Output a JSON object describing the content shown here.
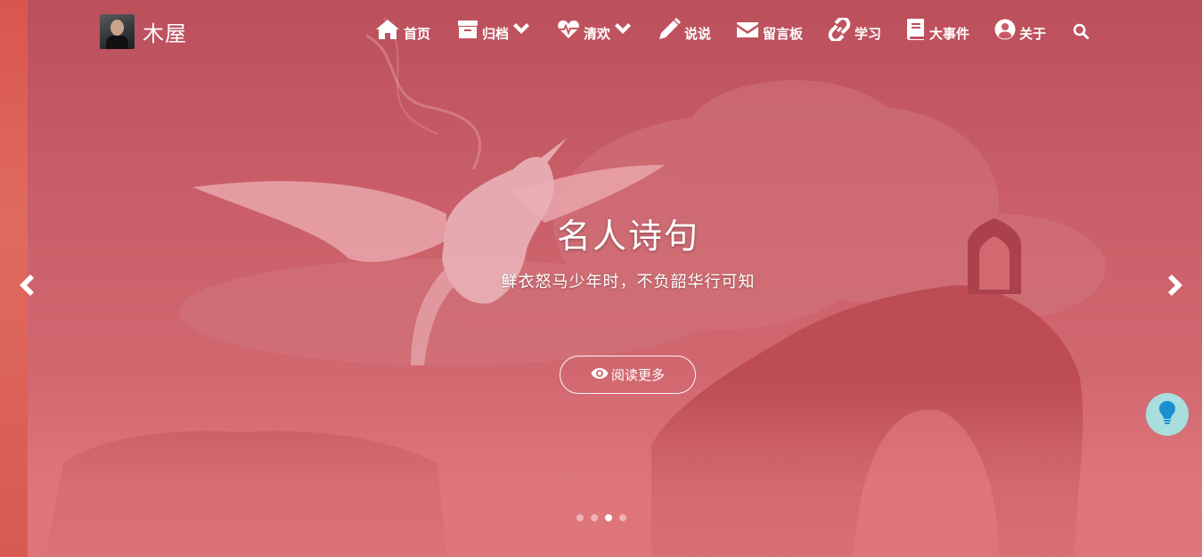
{
  "brand": {
    "name": "木屋"
  },
  "nav": {
    "items": [
      {
        "label": "首页",
        "icon": "home-icon"
      },
      {
        "label": "归档",
        "icon": "archive-icon",
        "dropdown": true
      },
      {
        "label": "清欢",
        "icon": "heartbeat-icon",
        "dropdown": true
      },
      {
        "label": "说说",
        "icon": "pencil-icon"
      },
      {
        "label": "留言板",
        "icon": "envelope-icon"
      },
      {
        "label": "学习",
        "icon": "link-icon"
      },
      {
        "label": "大事件",
        "icon": "book-icon"
      },
      {
        "label": "关于",
        "icon": "user-circle-icon"
      }
    ],
    "search_icon": "search-icon"
  },
  "hero": {
    "title": "名人诗句",
    "subtitle": "鲜衣怒马少年时，不负韶华行可知",
    "button_label": "阅读更多",
    "button_icon": "eye-icon"
  },
  "carousel": {
    "slide_count": 4,
    "active_index": 2,
    "prev_icon": "chevron-left-icon",
    "next_icon": "chevron-right-icon"
  },
  "floating_button": {
    "icon": "lightbulb-icon",
    "color": "#1a8fd0"
  },
  "colors": {
    "overlay": "#c95a64",
    "text": "#ffffff",
    "float_bg": "#a8dede"
  }
}
